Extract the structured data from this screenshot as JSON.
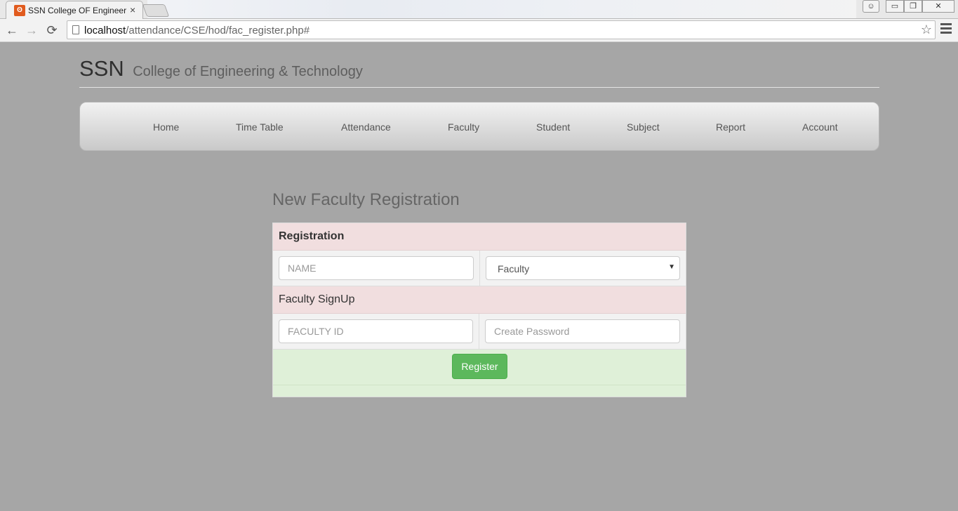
{
  "browser": {
    "tab_title": "SSN College OF Engineering",
    "tab_close": "×",
    "url_host": "localhost",
    "url_path": "/attendance/CSE/hod/fac_register.php#",
    "window_buttons": {
      "minimize": "▭",
      "maximize": "❐",
      "close": "✕"
    },
    "nav": {
      "back": "←",
      "forward": "→",
      "reload": "⟳"
    },
    "star": "☆"
  },
  "site": {
    "brand": "SSN",
    "brand_sub": "College of Engineering & Technology"
  },
  "navbar": {
    "items": [
      "Home",
      "Time Table",
      "Attendance",
      "Faculty",
      "Student",
      "Subject",
      "Report",
      "Account"
    ]
  },
  "form": {
    "title": "New Faculty Registration",
    "section_header": "Registration",
    "name_placeholder": "NAME",
    "role_select_value": "Faculty",
    "signup_header": "Faculty SignUp",
    "faculty_id_placeholder": "FACULTY ID",
    "password_placeholder": "Create Password",
    "register_label": "Register"
  },
  "colors": {
    "page_bg": "#a6a6a6",
    "header_row": "#f1dedf",
    "success_row": "#dff0d8",
    "button": "#5cb85c"
  }
}
